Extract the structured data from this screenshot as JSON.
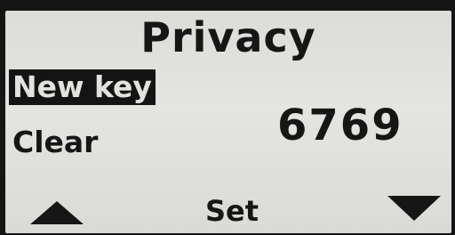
{
  "screen": {
    "title": "Privacy"
  },
  "menu": {
    "items": [
      {
        "label": "New key",
        "selected": true
      },
      {
        "label": "Clear",
        "selected": false
      }
    ]
  },
  "value": {
    "display": "6769"
  },
  "softkeys": {
    "left_icon": "up-arrow-icon",
    "center_label": "Set",
    "right_icon": "down-arrow-icon"
  },
  "colors": {
    "lcd_background": "#e0e0dc",
    "pixel_dark": "#161616"
  }
}
